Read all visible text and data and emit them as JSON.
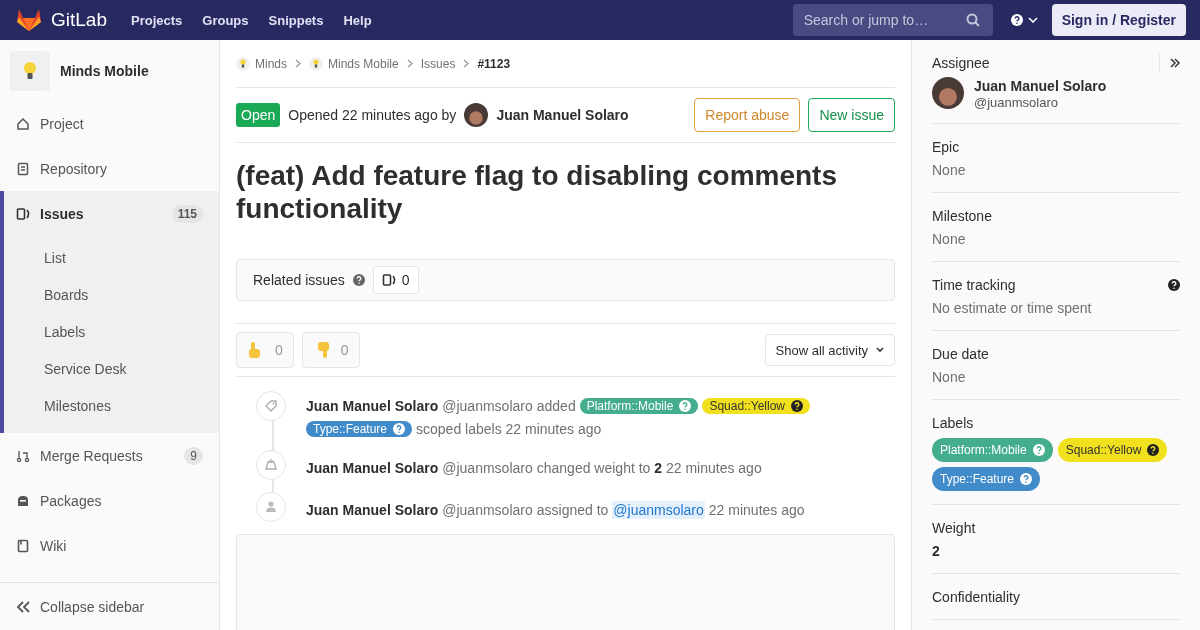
{
  "topbar": {
    "brand": "GitLab",
    "nav": [
      "Projects",
      "Groups",
      "Snippets",
      "Help"
    ],
    "search": {
      "placeholder": "Search or jump to…"
    },
    "sign_in": "Sign in / Register"
  },
  "sidebar": {
    "project": "Minds Mobile",
    "items": [
      {
        "label": "Project",
        "selected": false
      },
      {
        "label": "Repository",
        "selected": false
      },
      {
        "label": "Issues",
        "badge": "115",
        "selected": true,
        "children": [
          {
            "label": "List",
            "selected": false
          },
          {
            "label": "Boards",
            "selected": false
          },
          {
            "label": "Labels",
            "selected": false
          },
          {
            "label": "Service Desk",
            "selected": false
          },
          {
            "label": "Milestones",
            "selected": false
          }
        ]
      },
      {
        "label": "Merge Requests",
        "badge": "9",
        "selected": false
      },
      {
        "label": "Packages",
        "selected": false
      },
      {
        "label": "Wiki",
        "selected": false
      }
    ],
    "collapse": "Collapse sidebar"
  },
  "issue": {
    "breadcrumbs": [
      "Minds",
      "Minds Mobile",
      "Issues",
      "#1123"
    ],
    "status": "Open",
    "opened": "Opened 22 minutes ago by",
    "author": "Juan Manuel Solaro",
    "buttons": [
      "Report abuse",
      "New issue"
    ],
    "title": "(feat) Add feature flag to disabling comments functionality",
    "related": {
      "label": "Related issues",
      "count": "0"
    },
    "reactions": [
      "0",
      "0"
    ],
    "filter": "Show all activity",
    "notes": [
      {
        "kind": "label",
        "author": "Juan Manuel Solaro",
        "handle": "@juanmsolaro",
        "parts": [
          {
            "kind": "text",
            "text": "added"
          },
          {
            "kind": "label",
            "text": "Platform::Mobile",
            "color": "#44ad8e"
          },
          {
            "kind": "label",
            "text": "Squad::Yellow",
            "color": "#f0e01d"
          },
          {
            "kind": "label",
            "text": "Type::Feature",
            "color": "#428bca"
          },
          {
            "kind": "text",
            "text": "scoped labels 22 minutes ago"
          }
        ]
      },
      {
        "kind": "weight",
        "author": "Juan Manuel Solaro",
        "handle": "@juanmsolaro",
        "parts": [
          {
            "kind": "text",
            "text": "changed weight to **2** 22 minutes ago"
          }
        ]
      },
      {
        "kind": "assign",
        "author": "Juan Manuel Solaro",
        "handle": "@juanmsolaro",
        "parts": [
          {
            "kind": "text",
            "text": "assigned to"
          },
          {
            "kind": "mention",
            "text": "@juanmsolaro"
          },
          {
            "kind": "text",
            "text": "22 minutes ago"
          }
        ]
      }
    ]
  },
  "right_sidebar": {
    "assignee": {
      "heading": "Assignee",
      "name": "Juan Manuel Solaro",
      "handle": "@juanmsolaro"
    },
    "blocks": [
      {
        "heading": "Epic",
        "value": "None"
      },
      {
        "heading": "Milestone",
        "value": "None"
      },
      {
        "heading": "Time tracking",
        "value": "No estimate or time spent",
        "help": true
      },
      {
        "heading": "Due date",
        "value": "None"
      }
    ],
    "labels": {
      "heading": "Labels",
      "items": [
        {
          "text": "Platform::Mobile",
          "color": "#44ad8e"
        },
        {
          "text": "Squad::Yellow",
          "color": "#f0e01d"
        },
        {
          "text": "Type::Feature",
          "color": "#428bca"
        }
      ]
    },
    "weight": {
      "heading": "Weight",
      "value": "2"
    },
    "confidentiality": {
      "heading": "Confidentiality"
    }
  }
}
